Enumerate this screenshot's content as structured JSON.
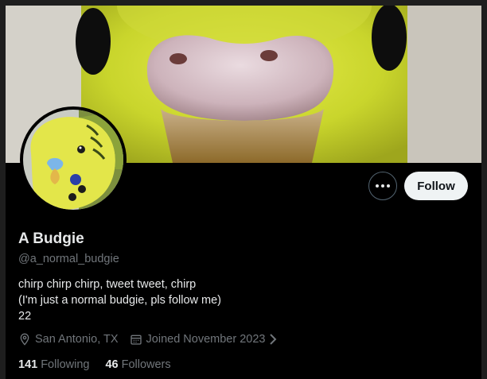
{
  "profile": {
    "display_name": "A Budgie",
    "handle": "@a_normal_budgie",
    "bio": "chirp chirp chirp, tweet tweet, chirp\n(I'm just a normal budgie, pls follow me)\n22",
    "location": "San Antonio, TX",
    "joined": "Joined November 2023",
    "following_count": "141",
    "following_label": "Following",
    "followers_count": "46",
    "followers_label": "Followers"
  },
  "actions": {
    "follow_label": "Follow",
    "more_icon": "more-horizontal-icon"
  },
  "icons": {
    "location": "location-pin-icon",
    "calendar": "calendar-icon",
    "chevron": "chevron-right-icon"
  },
  "colors": {
    "background": "#000000",
    "text_primary": "#e7e9ea",
    "text_secondary": "#71767b",
    "follow_button_bg": "#eff3f4",
    "budgie_yellow": "#d9e33a"
  }
}
